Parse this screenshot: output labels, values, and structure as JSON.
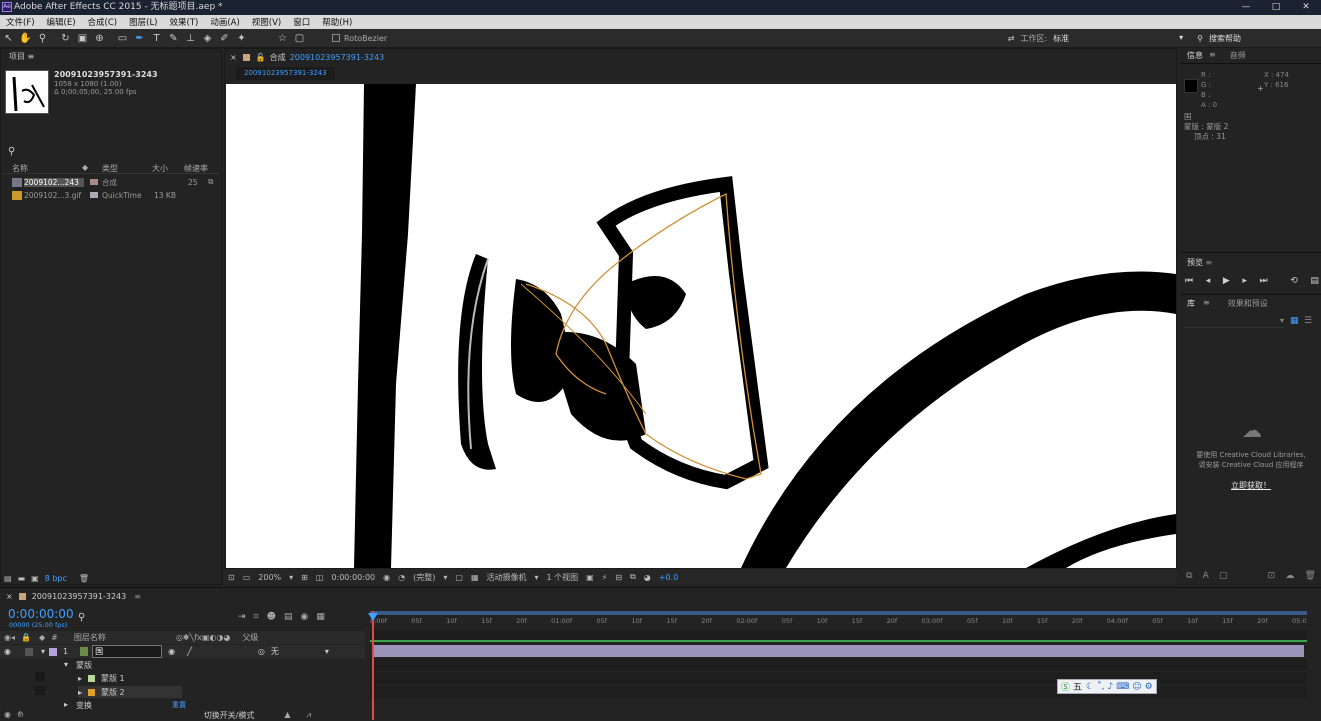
{
  "window": {
    "title": "Adobe After Effects CC 2015 - 无标题项目.aep *",
    "app_icon": "Ae",
    "controls": [
      "—",
      "□",
      "✕"
    ]
  },
  "menu": [
    "文件(F)",
    "编辑(E)",
    "合成(C)",
    "图层(L)",
    "效果(T)",
    "动画(A)",
    "视图(V)",
    "窗口",
    "帮助(H)"
  ],
  "toolbar": {
    "roto": "RotoBezier",
    "workspace_label": "工作区:",
    "workspace_value": "标准",
    "search_help": "搜索帮助"
  },
  "project": {
    "tab": "项目",
    "name": "20091023957391-3243",
    "size_line": "1058 x 1080 (1.00)",
    "duration_line": "Δ 0;00;05;00, 25.00 fps",
    "headers": {
      "name": "名称",
      "type": "类型",
      "size": "大小",
      "rate": "帧速率"
    },
    "items": [
      {
        "name": "2009102...243",
        "type": "合成",
        "size": "",
        "rate": "25"
      },
      {
        "name": "2009102...3.gif",
        "type": "QuickTime",
        "size": "13 KB",
        "rate": ""
      }
    ],
    "footer": {
      "bpc": "8 bpc"
    }
  },
  "comp": {
    "tab_prefix": "合成",
    "tab_name": "20091023957391-3243",
    "breadcrumb": "20091023957391-3243",
    "zoom": "200%",
    "time": "0:00:00:00",
    "resolution": "(完整)",
    "camera": "活动摄像机",
    "views": "1 个视图",
    "exposure": "+0.0"
  },
  "info": {
    "tabs": [
      "信息",
      "音频"
    ],
    "r": "R :",
    "g": "G :",
    "b": "B :",
    "a": "A : 0",
    "x": "X : 474",
    "y": "Y : 616",
    "layer_name": "国",
    "mask_line": "蒙版 : 蒙版 2",
    "vertices_line": "顶点 : 31"
  },
  "preview": {
    "tab": "预览"
  },
  "library": {
    "tabs": [
      "库",
      "效果和预设"
    ],
    "message_line1": "要使用 Creative Cloud Libraries,",
    "message_line2": "请安装 Creative Cloud 应用程序",
    "install_link": "立即获取！"
  },
  "timeline": {
    "comp_tab": "20091023957391-3243",
    "timecode": "0:00:00:00",
    "fps": "00000 (25.00 fps)",
    "col_num": "#",
    "col_name": "图层名称",
    "col_parent": "父级",
    "layer": {
      "num": "1",
      "name": "国",
      "parent": "无"
    },
    "masks_group": "蒙版",
    "mask1": "蒙版 1",
    "mask2": "蒙版 2",
    "transform": "变换",
    "transform_reset": "重置",
    "footer_toggle": "切换开关/模式",
    "ruler": [
      "0:00f",
      "05f",
      "10f",
      "15f",
      "20f",
      "01:00f",
      "05f",
      "10f",
      "15f",
      "20f",
      "02:00f",
      "05f",
      "10f",
      "15f",
      "20f",
      "03:00f",
      "05f",
      "10f",
      "15f",
      "20f",
      "04:00f",
      "05f",
      "10f",
      "15f",
      "20f",
      "05:0"
    ]
  },
  "ime": {
    "label": "五"
  }
}
